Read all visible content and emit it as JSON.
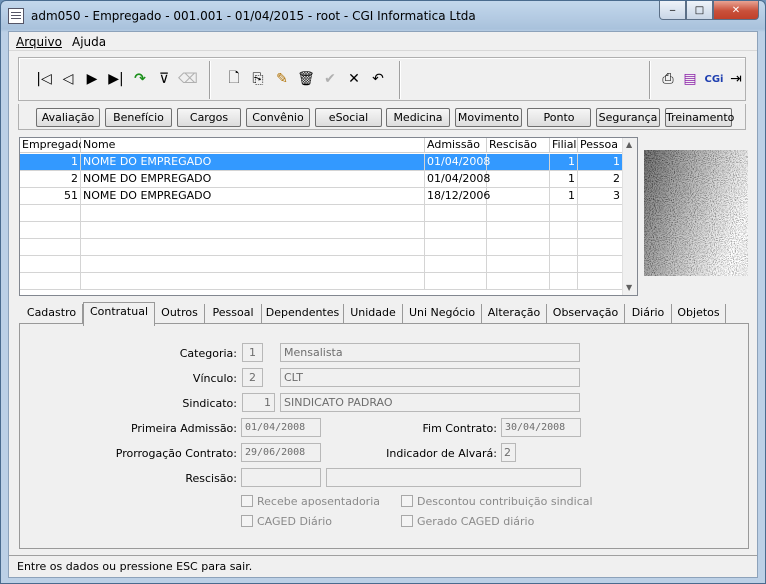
{
  "window": {
    "title": "adm050 - Empregado - 001.001 - 01/04/2015 - root - CGI Informatica Ltda",
    "minimize": "‒",
    "maximize": "□",
    "close": "✕"
  },
  "menu": [
    {
      "label": "Arquivo"
    },
    {
      "label": "Ajuda"
    }
  ],
  "toolbar": {
    "icons": [
      {
        "name": "first-record-icon",
        "glyph": "|◁"
      },
      {
        "name": "prev-record-icon",
        "glyph": "◁"
      },
      {
        "name": "next-record-icon",
        "glyph": "▶"
      },
      {
        "name": "last-record-icon",
        "glyph": "▶|"
      },
      {
        "name": "refresh-icon",
        "glyph": "↷"
      },
      {
        "name": "filter-icon",
        "glyph": "⊽"
      },
      {
        "name": "erase-filter-icon",
        "glyph": "⌫"
      },
      {
        "name": "new-icon",
        "glyph": "🗋"
      },
      {
        "name": "copy-icon",
        "glyph": "⎘"
      },
      {
        "name": "edit-icon",
        "glyph": "✎"
      },
      {
        "name": "delete-icon",
        "glyph": "🗑"
      },
      {
        "name": "confirm-icon",
        "glyph": "✔"
      },
      {
        "name": "cancel-icon",
        "glyph": "✕"
      },
      {
        "name": "undo-icon",
        "glyph": "↶"
      },
      {
        "name": "print-icon",
        "glyph": "⎙"
      },
      {
        "name": "books-icon",
        "glyph": "▤"
      },
      {
        "name": "cgi-logo-icon",
        "glyph": "CGi"
      },
      {
        "name": "exit-icon",
        "glyph": "⇥"
      }
    ]
  },
  "module_buttons": [
    {
      "label": "Avaliação"
    },
    {
      "label": "Benefício"
    },
    {
      "label": "Cargos"
    },
    {
      "label": "Convênio"
    },
    {
      "label": "eSocial"
    },
    {
      "label": "Medicina"
    },
    {
      "label": "Movimento"
    },
    {
      "label": "Ponto"
    },
    {
      "label": "Segurança"
    },
    {
      "label": "Treinamento"
    }
  ],
  "grid": {
    "headers": [
      "Empregado",
      "Nome",
      "Admissão",
      "Rescisão",
      "Filial",
      "Pessoa"
    ],
    "rows": [
      {
        "empregado": "1",
        "nome": "NOME DO EMPREGADO",
        "admissao": "01/04/2008",
        "rescisao": "",
        "filial": "1",
        "pessoa": "1",
        "selected": true
      },
      {
        "empregado": "2",
        "nome": "NOME DO EMPREGADO",
        "admissao": "01/04/2008",
        "rescisao": "",
        "filial": "1",
        "pessoa": "2",
        "selected": false
      },
      {
        "empregado": "51",
        "nome": "NOME DO EMPREGADO",
        "admissao": "18/12/2006",
        "rescisao": "",
        "filial": "1",
        "pessoa": "3",
        "selected": false
      }
    ]
  },
  "tabs": [
    {
      "label": "Cadastro"
    },
    {
      "label": "Contratual",
      "active": true
    },
    {
      "label": "Outros"
    },
    {
      "label": "Pessoal"
    },
    {
      "label": "Dependentes"
    },
    {
      "label": "Unidade"
    },
    {
      "label": "Uni Negócio"
    },
    {
      "label": "Alteração"
    },
    {
      "label": "Observação"
    },
    {
      "label": "Diário"
    },
    {
      "label": "Objetos"
    }
  ],
  "form": {
    "categoria_label": "Categoria:",
    "categoria_code": "1",
    "categoria_desc": "Mensalista",
    "vinculo_label": "Vínculo:",
    "vinculo_code": "2",
    "vinculo_desc": "CLT",
    "sindicato_label": "Sindicato:",
    "sindicato_code": "1",
    "sindicato_desc": "SINDICATO PADRAO",
    "primeira_admissao_label": "Primeira Admissão:",
    "primeira_admissao": "01/04/2008",
    "fim_contrato_label": "Fim Contrato:",
    "fim_contrato": "30/04/2008",
    "prorrogacao_label": "Prorrogação Contrato:",
    "prorrogacao": "29/06/2008",
    "alvara_label": "Indicador de Alvará:",
    "alvara": "2",
    "rescisao_label": "Rescisão:",
    "rescisao_code": "",
    "rescisao_desc": "",
    "checkboxes": [
      {
        "label": "Recebe aposentadoria",
        "checked": false
      },
      {
        "label": "Descontou contribuição sindical",
        "checked": false
      },
      {
        "label": "CAGED Diário",
        "checked": false
      },
      {
        "label": "Gerado CAGED diário",
        "checked": false
      }
    ]
  },
  "status": {
    "text": "Entre os dados ou pressione ESC para sair."
  }
}
